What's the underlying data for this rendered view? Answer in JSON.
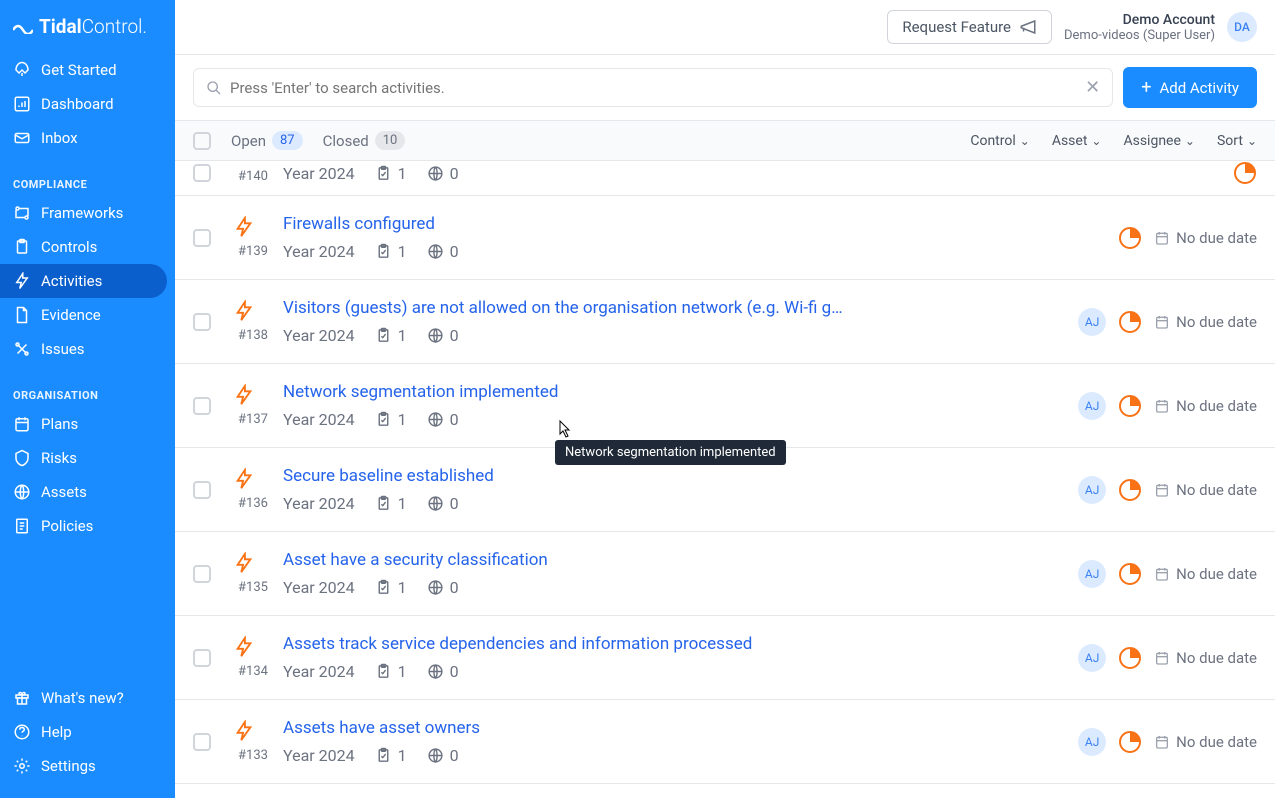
{
  "brand": {
    "strong": "Tidal",
    "light": "Control"
  },
  "nav": {
    "top": [
      {
        "label": "Get Started",
        "icon": "rocket"
      },
      {
        "label": "Dashboard",
        "icon": "chart"
      },
      {
        "label": "Inbox",
        "icon": "envelope"
      }
    ],
    "compliance_header": "COMPLIANCE",
    "compliance": [
      {
        "label": "Frameworks",
        "icon": "flow"
      },
      {
        "label": "Controls",
        "icon": "clipboard"
      },
      {
        "label": "Activities",
        "icon": "lightning",
        "active": true
      },
      {
        "label": "Evidence",
        "icon": "file"
      },
      {
        "label": "Issues",
        "icon": "tools"
      }
    ],
    "org_header": "ORGANISATION",
    "org": [
      {
        "label": "Plans",
        "icon": "calendar"
      },
      {
        "label": "Risks",
        "icon": "shield"
      },
      {
        "label": "Assets",
        "icon": "globe"
      },
      {
        "label": "Policies",
        "icon": "doc"
      }
    ],
    "footer": [
      {
        "label": "What's new?",
        "icon": "gift"
      },
      {
        "label": "Help",
        "icon": "question"
      },
      {
        "label": "Settings",
        "icon": "gear"
      }
    ]
  },
  "topbar": {
    "feature_btn": "Request Feature",
    "account_name": "Demo Account",
    "account_sub": "Demo-videos (Super User)",
    "avatar": "DA"
  },
  "toolbar": {
    "search_placeholder": "Press 'Enter' to search activities.",
    "add_btn": "Add Activity"
  },
  "filters": {
    "open_label": "Open",
    "open_count": "87",
    "closed_label": "Closed",
    "closed_count": "10",
    "control": "Control",
    "asset": "Asset",
    "assignee": "Assignee",
    "sort": "Sort"
  },
  "common": {
    "year": "Year 2024",
    "count1": "1",
    "count0": "0",
    "due": "No due date",
    "aj": "AJ"
  },
  "rows": [
    {
      "id": "#140",
      "title": "",
      "partial": true,
      "assignee": false
    },
    {
      "id": "#139",
      "title": "Firewalls configured",
      "assignee": false
    },
    {
      "id": "#138",
      "title": "Visitors (guests) are not allowed on the organisation network (e.g. Wi-fi g…",
      "assignee": true
    },
    {
      "id": "#137",
      "title": "Network segmentation implemented",
      "assignee": true
    },
    {
      "id": "#136",
      "title": "Secure baseline established",
      "assignee": true
    },
    {
      "id": "#135",
      "title": "Asset have a security classification",
      "assignee": true
    },
    {
      "id": "#134",
      "title": "Assets track service dependencies and information processed",
      "assignee": true
    },
    {
      "id": "#133",
      "title": "Assets have asset owners",
      "assignee": true
    }
  ],
  "tooltip": "Network segmentation implemented"
}
